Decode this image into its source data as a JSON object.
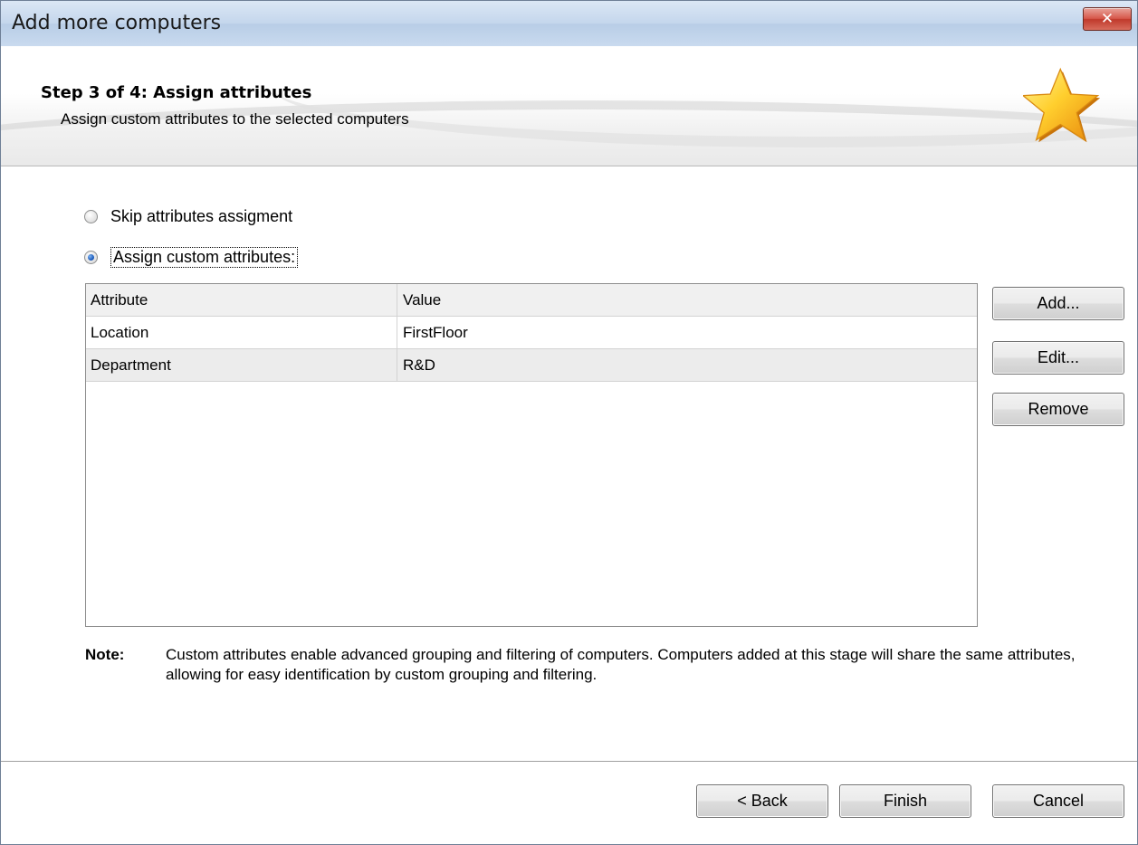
{
  "window": {
    "title": "Add more computers",
    "close_glyph": "✕"
  },
  "header": {
    "step_title": "Step 3 of 4: Assign attributes",
    "step_subtitle": "Assign custom attributes to the selected computers",
    "icon": "star-icon"
  },
  "options": {
    "skip_label": "Skip attributes assigment",
    "assign_label": "Assign custom attributes:",
    "selected": "assign"
  },
  "table": {
    "columns": [
      "Attribute",
      "Value"
    ],
    "rows": [
      {
        "attribute": "Location",
        "value": "FirstFloor"
      },
      {
        "attribute": "Department",
        "value": "R&D"
      }
    ]
  },
  "side_buttons": {
    "add": "Add...",
    "edit": "Edit...",
    "remove": "Remove"
  },
  "note": {
    "label": "Note:",
    "text": "Custom attributes enable advanced grouping and filtering of computers. Computers added at this stage will share the same attributes, allowing for easy identification by custom grouping and filtering."
  },
  "footer": {
    "back": "< Back",
    "finish": "Finish",
    "cancel": "Cancel"
  },
  "colors": {
    "radio_selected": "#1f5fbf",
    "close_button": "#c0392b",
    "star": "#f7b500"
  }
}
